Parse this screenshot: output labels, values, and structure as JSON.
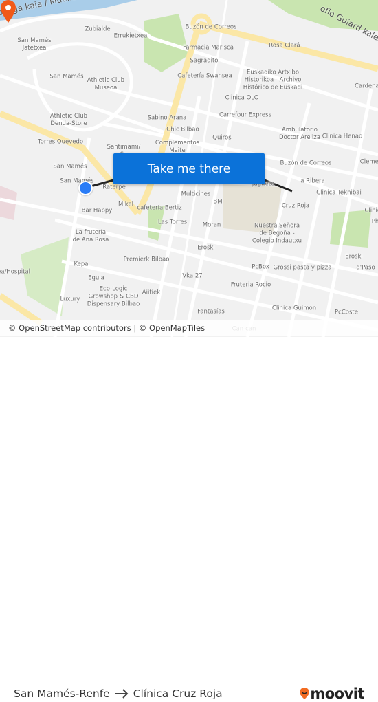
{
  "map": {
    "streets": [
      "beaga kaia / Muelle de Olabeaga",
      "ofio Guiard kalea"
    ],
    "labels": [
      "Zubialde",
      "Errukietxea",
      "San Mamés\nJatetxea",
      "San Mamés",
      "Athletic Club\nMuseoa",
      "Athletic Club\nDenda-Store",
      "Torres Quevedo",
      "San Mamés",
      "San Mamés",
      "Raterpe",
      "Mikel",
      "cafetería Bertiz",
      "Bar Happy",
      "Las Torres",
      "La frutería\nde Ana Rosa",
      "Kepa",
      "Premierk Bilbao",
      "ea/Hospital",
      "Eguia",
      "Eco-Logic\nGrowshop & CBD\nDispensary Bilbao",
      "Aiitiek",
      "Luxury",
      "Buzón de Correos",
      "Farmacia Marisca",
      "Sagradito",
      "Cafetería Swansea",
      "Rosa Clará",
      "Euskadiko Artxibo\nHistorikoa - Archivo\nHistórico de Euskadi",
      "Clinica OLO",
      "Carrefour Express",
      "Sabino Arana",
      "Chic Bilbao",
      "Quiros",
      "Complementos\nMaite",
      "Santimami/\nSa",
      "Ambulatorio\nDoctor Areilza",
      "Clinica Henao",
      "Buzón de Correos",
      "Cardenal",
      "Clemen",
      "Juguete",
      "a Ribera",
      "Clinica Teknibai",
      "Cruz Roja",
      "Multicines",
      "BM",
      "Moran",
      "Nuestra Señora\nde Begoña -\nColegio Indautxu",
      "Eroski",
      "Eroski",
      "PcBox",
      "Grossi pasta y pizza",
      "d'Paso",
      "Vka 27",
      "Fruteria Rocio",
      "Clinica Guimon",
      "PcCoste",
      "Fantasías",
      "Can-can",
      "Clinic",
      "Ph"
    ],
    "cta_label": "Take me there",
    "attribution": "© OpenStreetMap contributors | © OpenMapTiles",
    "origin_marker_color": "#2a7cf6",
    "destination_marker_color": "#f05a1a",
    "cta_color": "#0b72d9"
  },
  "footer": {
    "origin": "San Mamés-Renfe",
    "arrow_icon": "arrow-right-icon",
    "destination": "Clínica Cruz Roja",
    "brand": "moovit",
    "brand_color": "#f26b21"
  }
}
